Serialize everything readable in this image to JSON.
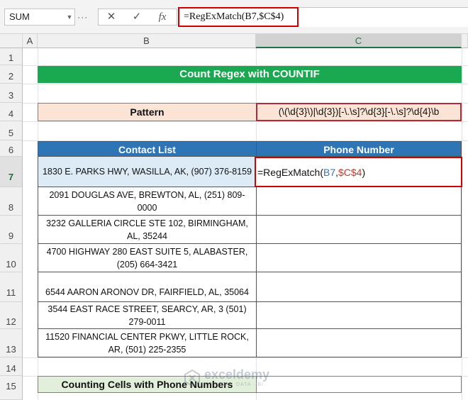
{
  "formula_bar": {
    "name_box": "SUM",
    "cancel_glyph": "✕",
    "enter_glyph": "✓",
    "fx_label": "fx",
    "formula": "=RegExMatch(B7,$C$4)"
  },
  "columns": [
    "A",
    "B",
    "C"
  ],
  "rows": [
    "1",
    "2",
    "3",
    "4",
    "5",
    "6",
    "7",
    "8",
    "9",
    "10",
    "11",
    "12",
    "13",
    "14",
    "15"
  ],
  "sheet": {
    "title": "Count Regex with COUNTIF",
    "pattern_label": "Pattern",
    "pattern_value": "(\\(\\d{3}\\)|\\d{3})[-\\.\\s]?\\d{3}[-\\.\\s]?\\d{4}\\b",
    "table_headers": [
      "Contact List",
      "Phone Number"
    ],
    "contacts": [
      "1830 E. PARKS HWY, WASILLA, AK, (907) 376-8159",
      "2091 DOUGLAS AVE, BREWTON, AL, (251) 809-0000",
      "3232 GALLERIA CIRCLE STE 102, BIRMINGHAM, AL, 35244",
      "4700 HIGHWAY 280 EAST SUITE 5, ALABASTER, (205) 664-3421",
      "6544 AARON ARONOV DR, FAIRFIELD, AL, 35064",
      "3544 EAST RACE STREET, SEARCY, AR, 3 (501) 279-0011",
      "11520 FINANCIAL CENTER PKWY, LITTLE ROCK, AR, (501) 225-2355"
    ],
    "active_cell_formula": {
      "prefix": "=RegExMatch(",
      "ref1": "B7",
      "sep": ",",
      "ref2": "$C$4",
      "suffix": ")"
    },
    "count_label": "Counting Cells with Phone Numbers"
  },
  "colors": {
    "title_green": "#1aa850",
    "header_blue": "#2e75b6",
    "pattern_fill": "#fbe4d5",
    "count_fill": "#e2efda",
    "highlight_red": "#d00000",
    "ref_blue": "#2f75b5",
    "ref_red": "#c0392b"
  },
  "watermark": {
    "name": "exceldemy",
    "tagline": "EXCEL · DATA · BI"
  }
}
